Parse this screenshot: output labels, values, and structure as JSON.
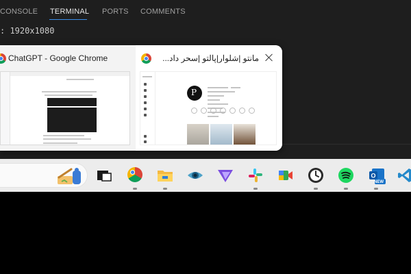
{
  "panel": {
    "tabs": [
      {
        "label": "CONSOLE"
      },
      {
        "label": "TERMINAL",
        "active": true
      },
      {
        "label": "PORTS"
      },
      {
        "label": "COMMENTS"
      }
    ],
    "terminal_line": ": 1920x1080"
  },
  "popup": {
    "windows": [
      {
        "title": "ChatGPT - Google Chrome",
        "icon": "chrome-icon"
      },
      {
        "title": "مانتو |شلوار|پالتو |سحر داد...",
        "icon": "chrome-icon",
        "close_icon": "close-icon"
      }
    ]
  },
  "taskbar": {
    "icons": [
      "search-widget-icon",
      "task-view-icon",
      "chrome-icon",
      "file-explorer-icon",
      "eye-icon",
      "proton-vpn-icon",
      "slack-icon",
      "google-meet-icon",
      "clock-app-icon",
      "spotify-icon",
      "outlook-new-icon",
      "vscode-icon"
    ],
    "outlook_badge": "NEW"
  },
  "colors": {
    "panel_bg": "#1e1e1e",
    "tab_active_underline": "#3b8eea",
    "taskbar_bg": "#ececec",
    "popup_bg": "#f3f3f3"
  }
}
